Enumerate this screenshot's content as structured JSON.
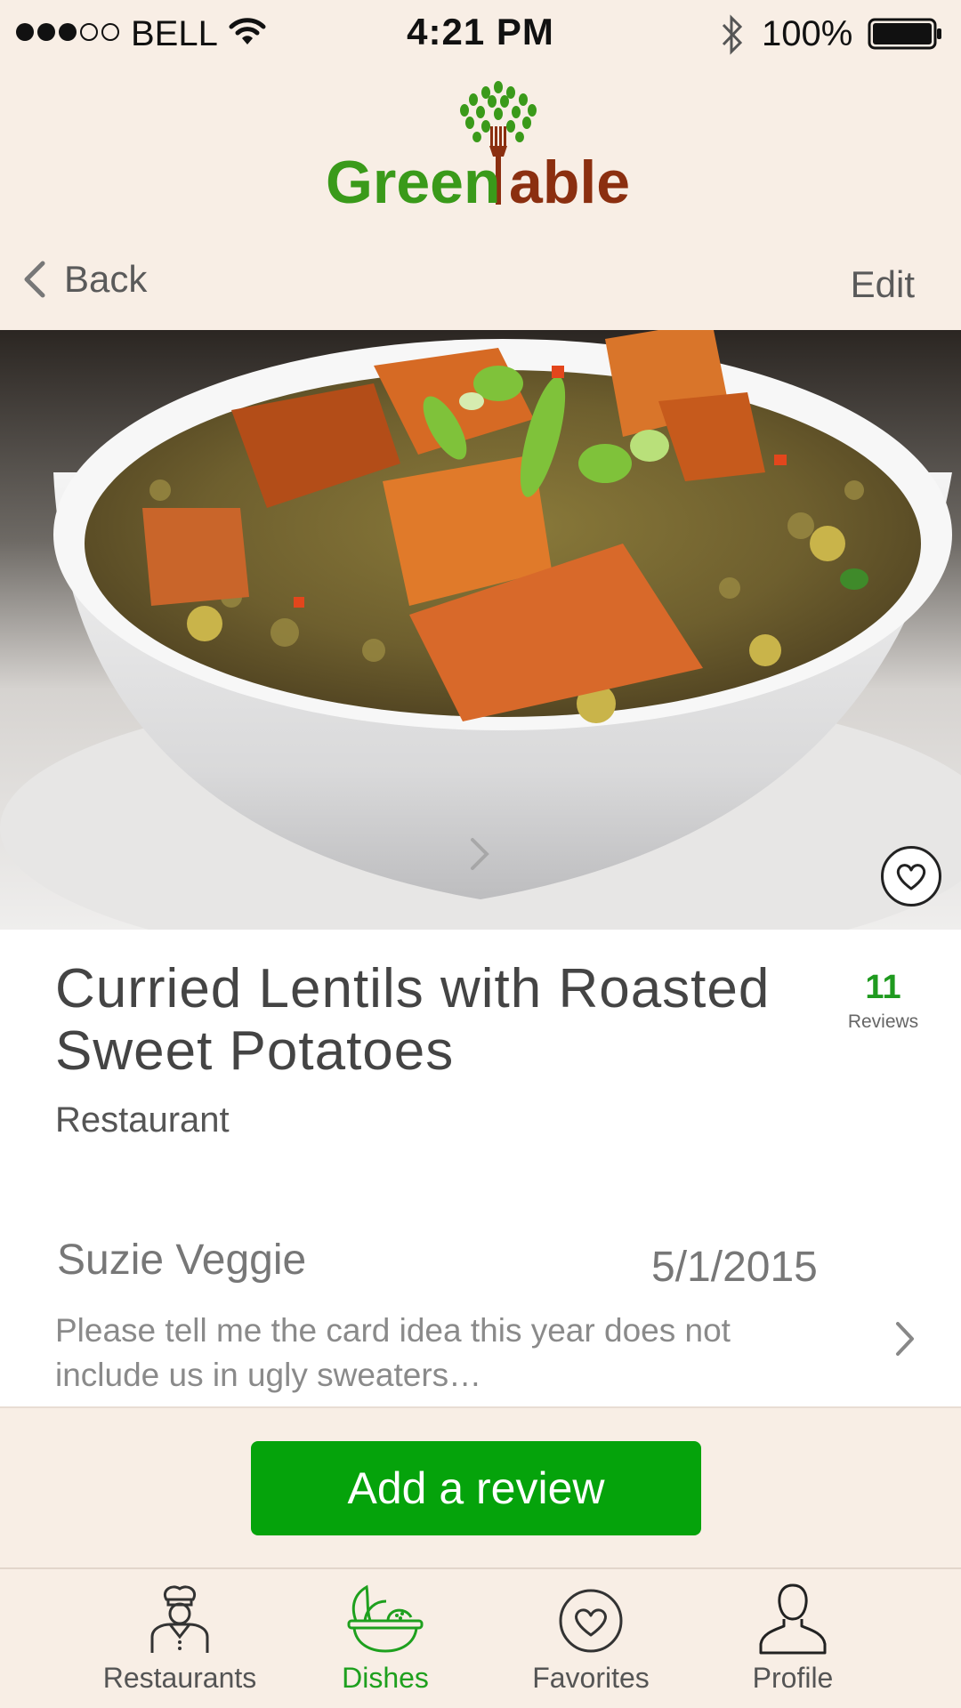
{
  "status_bar": {
    "signal_full": 3,
    "signal_total": 5,
    "carrier": "BELL",
    "time": "4:21 PM",
    "battery": "100%"
  },
  "logo": {
    "text_green": "Green",
    "text_brown": "able",
    "colors": {
      "green": "#3a9a1a",
      "brown": "#8b2f10"
    }
  },
  "nav": {
    "back_label": "Back",
    "edit_label": "Edit"
  },
  "dish": {
    "title": "Curried Lentils with Roasted Sweet Potatoes",
    "restaurant": "Restaurant",
    "review_count": "11",
    "review_count_label": "Reviews"
  },
  "review": {
    "author": "Suzie Veggie",
    "date": "5/1/2015",
    "text": "Please tell me the card idea this year does not include us in ugly sweaters…"
  },
  "actions": {
    "add_review_label": "Add a review"
  },
  "tabs": [
    {
      "label": "Restaurants",
      "icon": "chef-icon",
      "active": false
    },
    {
      "label": "Dishes",
      "icon": "bowl-icon",
      "active": true
    },
    {
      "label": "Favorites",
      "icon": "heart-icon",
      "active": false
    },
    {
      "label": "Profile",
      "icon": "person-icon",
      "active": false
    }
  ],
  "colors": {
    "background": "#f8eee5",
    "accent_green": "#05a30b",
    "active_tab": "#1ea01e"
  }
}
